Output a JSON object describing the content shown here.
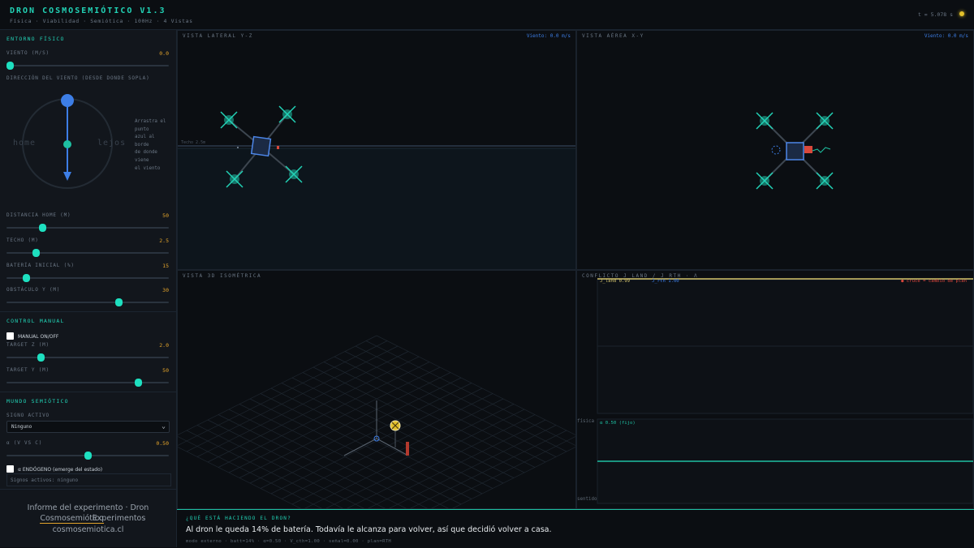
{
  "app": {
    "title": "Dron Cosmosemiótico v1.3",
    "subtitle": "Física · Viabilidad · Semiótica · 100Hz · 4 Vistas",
    "clock": "t = 5.078 s"
  },
  "sidebar": {
    "entorno": {
      "section": "ENTORNO FÍSICO",
      "viento": {
        "label": "VIENTO (M/S)",
        "value": "0.0",
        "fraction": 0.02
      },
      "direccion_label": "DIRECCIÓN DEL VIENTO (DESDE DONDE SOPLA)",
      "dial_home": "home",
      "dial_lejos": "lejos",
      "hint": [
        "Arrastra el",
        "punto",
        "azul al",
        "borde",
        "de donde",
        "viene",
        "el viento"
      ],
      "distancia": {
        "label": "DISTANCIA HOME (M)",
        "value": "50",
        "fraction": 0.22
      },
      "techo": {
        "label": "TECHO (M)",
        "value": "2.5",
        "fraction": 0.18
      },
      "bateria": {
        "label": "BATERÍA INICIAL (%)",
        "value": "15",
        "fraction": 0.12
      },
      "obstaculo": {
        "label": "OBSTÁCULO Y (M)",
        "value": "30",
        "fraction": 0.69
      }
    },
    "control": {
      "section": "CONTROL MANUAL",
      "manual_label": "MANUAL ON/OFF",
      "target_z": {
        "label": "TARGET Z (M)",
        "value": "2.0",
        "fraction": 0.21
      },
      "target_y": {
        "label": "TARGET Y (M)",
        "value": "50",
        "fraction": 0.81
      }
    },
    "mundo": {
      "section": "MUNDO SEMIÓTICO",
      "signo_label": "SIGNO ACTIVO",
      "signo_value": "Ninguno",
      "alpha": {
        "label": "α (V VS C)",
        "value": "0.50",
        "fraction": 0.5
      },
      "endogeno_label": "α ENDÓGENO (emerge del estado)",
      "signos_activos": "Signos activos: ninguno"
    },
    "footer": {
      "line1": "Informe del experimento · Dron",
      "link1": "Cosmosemiótico",
      "link2": "Experimentos",
      "line3": "cosmosemiotica.cl"
    }
  },
  "views": {
    "lateral": {
      "title": "VISTA LATERAL Y-Z",
      "wind": "Viento: 0.0 m/s",
      "techo_label": "Techo 2.5m"
    },
    "aerea": {
      "title": "VISTA AÉREA X-Y",
      "wind": "Viento: 0.0 m/s"
    },
    "iso": {
      "title": "VISTA 3D ISOMÉTRICA"
    },
    "conflicto": {
      "title": "CONFLICTO J_LAND / J_RTH · Λ",
      "j_land": "J_land 0.99",
      "j_rth": "J_rth 1.00",
      "cruce": "● cruce = cambio de plan",
      "fisica_label": "física",
      "sentido_label": "sentido",
      "alpha_fijo": "α 0.50 (fijo)",
      "alpha_level": 0.5
    }
  },
  "narrative": {
    "heading": "¿QUÉ ESTÁ HACIENDO EL DRON?",
    "text": "Al dron le queda 14% de batería. Todavía le alcanza para volver, así que decidió volver a casa.",
    "status": "modo externo · batt=14% · α=0.50 · V_cth=1.00 · señal=0.00 · plan=RTH"
  },
  "colors": {
    "accent": "#22d3b6",
    "amber": "#e2a32b",
    "blue": "#3d7ee6",
    "red": "#d9483b"
  }
}
